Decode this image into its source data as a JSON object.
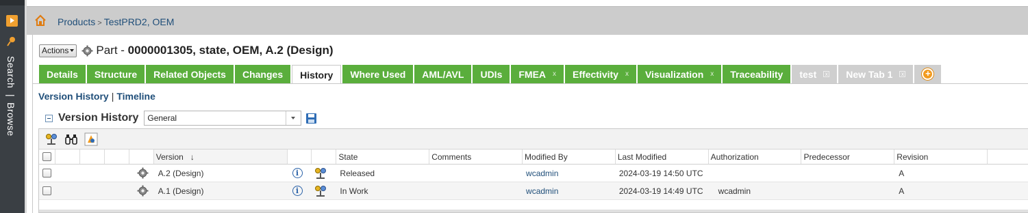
{
  "navigator": {
    "label_search": "Search",
    "label_separator": "|",
    "label_browse": "Browse"
  },
  "breadcrumb": {
    "products": "Products",
    "separator": ">",
    "current": "TestPRD2, OEM"
  },
  "header": {
    "actions_label": "Actions",
    "object_type": "Part - ",
    "object_id": "0000001305, state, OEM, A.2 (Design)"
  },
  "tabs": [
    {
      "label": "Details",
      "closable": false
    },
    {
      "label": "Structure",
      "closable": false
    },
    {
      "label": "Related Objects",
      "closable": false
    },
    {
      "label": "Changes",
      "closable": false
    },
    {
      "label": "History",
      "closable": false,
      "active": true
    },
    {
      "label": "Where Used",
      "closable": false
    },
    {
      "label": "AML/AVL",
      "closable": false
    },
    {
      "label": "UDIs",
      "closable": false
    },
    {
      "label": "FMEA",
      "closable": true
    },
    {
      "label": "Effectivity",
      "closable": true
    },
    {
      "label": "Visualization",
      "closable": true
    },
    {
      "label": "Traceability",
      "closable": false
    },
    {
      "label": "test",
      "closable": true,
      "grey": true
    },
    {
      "label": "New Tab 1",
      "closable": true,
      "grey": true
    }
  ],
  "tab_close_glyph": "x",
  "subnav": {
    "version_history": "Version History",
    "separator": "|",
    "timeline": "Timeline"
  },
  "version_history": {
    "title": "Version History",
    "view_selected": "General"
  },
  "table": {
    "columns": {
      "version": "Version",
      "state": "State",
      "comments": "Comments",
      "modified_by": "Modified By",
      "last_modified": "Last Modified",
      "authorization": "Authorization",
      "predecessor": "Predecessor",
      "revision": "Revision"
    },
    "sort_indicator": "↓",
    "rows": [
      {
        "version": "A.2 (Design)",
        "state": "Released",
        "comments": "",
        "modified_by": "wcadmin",
        "last_modified": "2024-03-19 14:50 UTC",
        "authorization": "",
        "predecessor": "",
        "revision": "A"
      },
      {
        "version": "A.1 (Design)",
        "state": "In Work",
        "comments": "",
        "modified_by": "wcadmin",
        "last_modified": "2024-03-19 14:49 UTC",
        "authorization": "wcadmin",
        "predecessor": "",
        "revision": "A"
      }
    ]
  },
  "colors": {
    "tab_green": "#5aae3c",
    "link_blue": "#1f4e79",
    "navigator_bg": "#3a3f44",
    "accent_orange": "#f29b1f"
  }
}
